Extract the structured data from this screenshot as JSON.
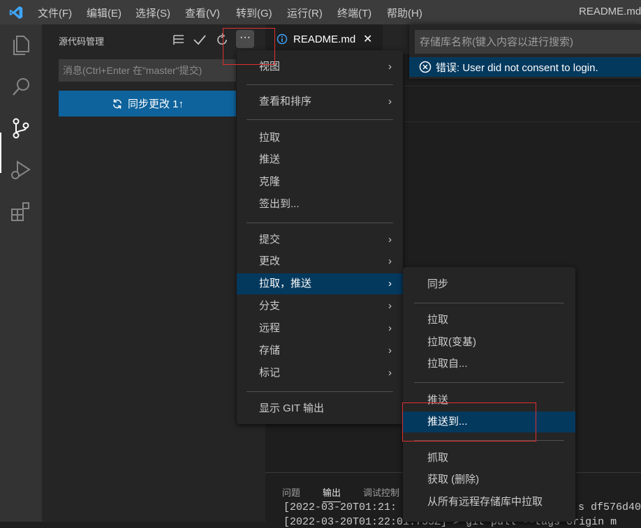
{
  "menubar": {
    "items": [
      "文件(F)",
      "编辑(E)",
      "选择(S)",
      "查看(V)",
      "转到(G)",
      "运行(R)",
      "终端(T)",
      "帮助(H)"
    ],
    "window_title": "README.md -"
  },
  "sidebar": {
    "title": "源代码管理",
    "message_placeholder": "消息(Ctrl+Enter 在\"master\"提交)",
    "sync_button": "同步更改 1↑",
    "more_label": "···"
  },
  "editor": {
    "tab_label": "README.md",
    "tab_close": "✕"
  },
  "quickpick": {
    "placeholder": "存储库名称(键入内容以进行搜索)",
    "error_item": "错误: User did not consent to login."
  },
  "panel": {
    "tabs": [
      "问题",
      "输出",
      "调试控制"
    ],
    "active_tab": "输出",
    "line1": "[2022-03-20T01:21:",
    "line1_tail": "s df576d40",
    "line2": "[2022-03-20T01:22:01.733Z] > git pull --tags origin m"
  },
  "menu_main": {
    "items": [
      "视图",
      "查看和排序",
      "拉取",
      "推送",
      "克隆",
      "签出到...",
      "提交",
      "更改",
      "拉取，推送",
      "分支",
      "远程",
      "存储",
      "标记",
      "显示 GIT 输出"
    ],
    "selected": "拉取，推送"
  },
  "menu_sub": {
    "items": [
      "同步",
      "拉取",
      "拉取(变基)",
      "拉取自...",
      "推送",
      "推送到...",
      "抓取",
      "获取 (删除)",
      "从所有远程存储库中拉取"
    ],
    "selected": "推送到..."
  },
  "colors": {
    "accent": "#0e639c",
    "selection": "#04395e",
    "highlight_box": "#e03030"
  }
}
